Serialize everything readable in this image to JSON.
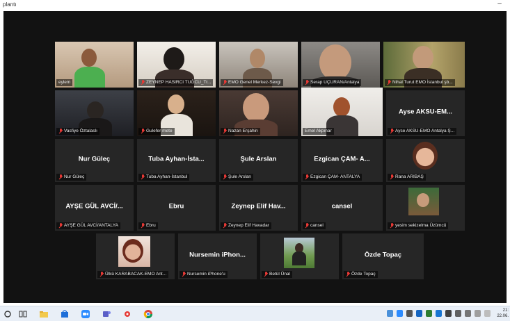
{
  "window": {
    "title": "plantı",
    "minimize_glyph": "–"
  },
  "participants": [
    {
      "label": "eylem"
    },
    {
      "label": "ZEYNEP HASIRCI TUĞCU_Tr..."
    },
    {
      "label": "EMO Genel Merkez-Sevgi"
    },
    {
      "label": "Serap UÇURAN/Antalya"
    },
    {
      "label": "Nihal Turut EMO İstanbul şb..."
    },
    {
      "label": "Vasfiye Öztalaslı"
    },
    {
      "label": "Gulefer mete"
    },
    {
      "label": "Nazan Erşahin"
    },
    {
      "label": "Emel Akpınar"
    },
    {
      "name": "Ayse AKSU-EM...",
      "label": "Ayse AKSU-EMO Antalya Ş..."
    },
    {
      "name": "Nur Güleç",
      "label": "Nur Güleç"
    },
    {
      "name": "Tuba Ayhan-İsta...",
      "label": "Tuba Ayhan-İstanbul"
    },
    {
      "name": "Şule Arslan",
      "label": "Şule Arslan"
    },
    {
      "name": "Ezgican ÇAM- A...",
      "label": "Ezgican ÇAM- ANTALYA"
    },
    {
      "label": "Rana ARIBAŞ"
    },
    {
      "name": "AYŞE GÜL AVCİ/...",
      "label": "AYŞE GÜL AVCİ/ANTALYA"
    },
    {
      "name": "Ebru",
      "label": "Ebru"
    },
    {
      "name": "Zeynep Elif Hav...",
      "label": "Zeynep Elif Havadar"
    },
    {
      "name": "cansel",
      "label": "cansel"
    },
    {
      "label": "yesim sekizelma Üzümcü"
    },
    {
      "label": "Ülkü KARABACAK-EMO Ant..."
    },
    {
      "name": "Nursemin iPhon...",
      "label": "Nursemin iPhone'u"
    },
    {
      "label": "Betül Ünal"
    },
    {
      "name": "Özde Topaç",
      "label": "Özde Topaç"
    }
  ],
  "taskbar": {
    "apps": [
      "search-icon",
      "task-view-icon",
      "file-explorer-icon",
      "store-icon",
      "zoom-icon",
      "teams-icon",
      "settings-icon",
      "chrome-icon"
    ],
    "clock_time": "21:",
    "clock_date": "22.06."
  },
  "colors": {
    "active_speaker": "#9acd32",
    "muted_mic": "#e53935",
    "stage": "#121212",
    "tile": "#262626"
  }
}
